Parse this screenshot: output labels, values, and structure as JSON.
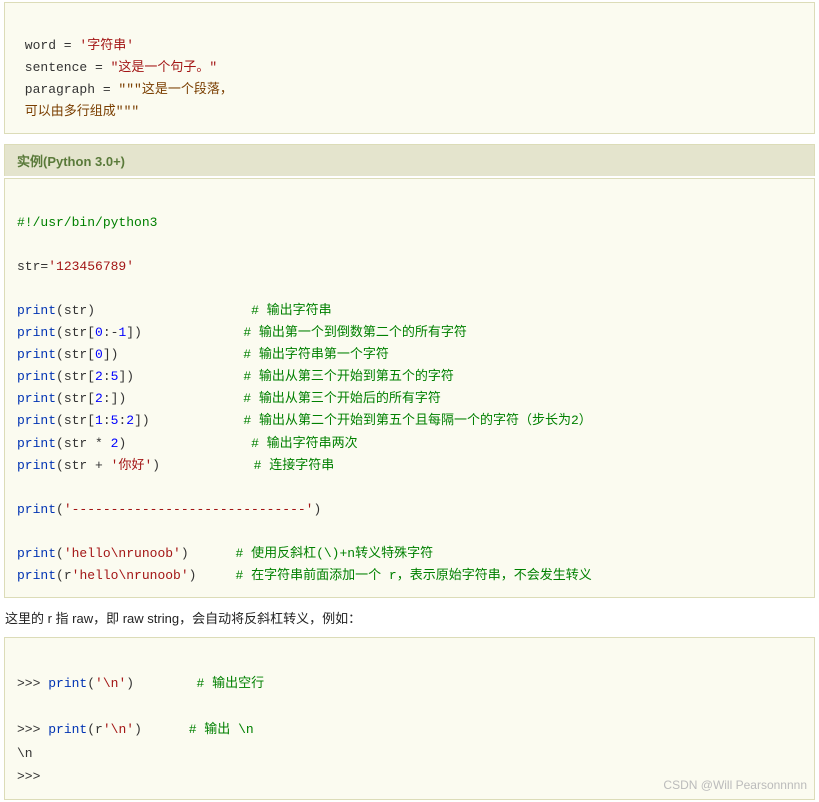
{
  "box1": {
    "line1_left": " word = ",
    "line1_str": "'字符串'",
    "line2_left": " sentence = ",
    "line2_str": "\"这是一个句子。\"",
    "line3_left": " paragraph = ",
    "line3_str": "\"\"\"这是一个段落，",
    "line4_str": " 可以由多行组成\"\"\""
  },
  "header": "实例(Python 3.0+)",
  "box2": {
    "shebang": "#!/usr/bin/python3",
    "assign_left": "str=",
    "assign_str": "'123456789'",
    "p": "print",
    "l1_in": "str",
    "l1_c": "# 输出字符串",
    "l2_in_a": "str[",
    "l2_in_b": "0",
    "l2_in_c": ":-",
    "l2_in_d": "1",
    "l2_in_e": "]",
    "l2_c": "# 输出第一个到倒数第二个的所有字符",
    "l3_in_a": "str[",
    "l3_in_b": "0",
    "l3_in_c": "]",
    "l3_c": "# 输出字符串第一个字符",
    "l4_in_a": "str[",
    "l4_in_b": "2",
    "l4_in_c": ":",
    "l4_in_d": "5",
    "l4_in_e": "]",
    "l4_c": "# 输出从第三个开始到第五个的字符",
    "l5_in_a": "str[",
    "l5_in_b": "2",
    "l5_in_c": ":]",
    "l5_c": "# 输出从第三个开始后的所有字符",
    "l6_in_a": "str[",
    "l6_in_b": "1",
    "l6_in_c": ":",
    "l6_in_d": "5",
    "l6_in_e": ":",
    "l6_in_f": "2",
    "l6_in_g": "]",
    "l6_c": "# 输出从第二个开始到第五个且每隔一个的字符（步长为2）",
    "l7_in": "str * ",
    "l7_n": "2",
    "l7_c": "# 输出字符串两次",
    "l8_in": "str + ",
    "l8_s": "'你好'",
    "l8_c": "# 连接字符串",
    "sep": "'------------------------------'",
    "l10_s": "'hello\\nrunoob'",
    "l10_c": "# 使用反斜杠(\\)+n转义特殊字符",
    "l11_pre": "r",
    "l11_s": "'hello\\nrunoob'",
    "l11_c": "# 在字符串前面添加一个 r，表示原始字符串，不会发生转义"
  },
  "text_between": "这里的 r 指 raw，即 raw string，会自动将反斜杠转义，例如：",
  "console": {
    "p1": ">>> ",
    "p1f": "print",
    "p1a": "(",
    "p1s": "'\\n'",
    "p1b": ")",
    "p1c": "# 输出空行",
    "blank": "",
    "p2": ">>> ",
    "p2f": "print",
    "p2a": "(r",
    "p2s": "'\\n'",
    "p2b": ")",
    "p2c": "# 输出 \\n",
    "out": "\\n",
    "p3": ">>> "
  },
  "watermark": "CSDN @Will Pearsonnnnn"
}
